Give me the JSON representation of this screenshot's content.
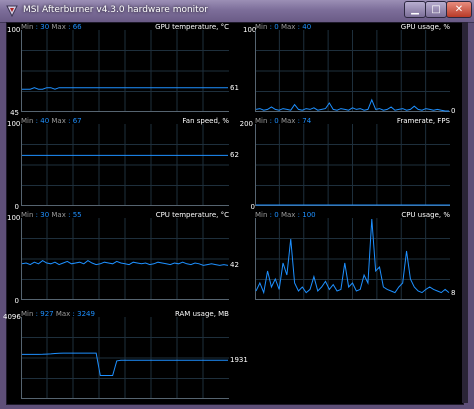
{
  "window": {
    "title": "MSI Afterburner v4.3.0 hardware monitor",
    "minimize_glyph": "▁",
    "maximize_glyph": "□",
    "close_glyph": "✕",
    "icon": "afterburner-icon"
  },
  "labels": {
    "min": "Min",
    "max": "Max"
  },
  "colors": {
    "graph_line": "#1e90ff",
    "grid": "#1e2f3c",
    "axis": "#566470",
    "background": "#000000"
  },
  "graphs": {
    "gpu_temp": {
      "name": "GPU temperature, °C",
      "min": "30",
      "max": "66",
      "y_top": "100",
      "y_bottom": "45",
      "current": "61",
      "range": [
        45,
        100
      ],
      "samples": [
        60,
        60,
        60,
        61,
        60,
        60,
        61,
        61,
        60,
        61,
        61,
        61,
        61,
        61,
        61,
        61,
        61,
        61,
        61,
        61,
        61,
        61,
        61,
        61,
        61,
        61,
        61,
        61,
        61,
        61,
        61,
        61,
        61,
        61,
        61,
        61,
        61,
        61,
        61,
        61,
        61,
        61,
        61,
        61,
        61,
        61,
        61,
        61,
        61,
        61,
        61
      ]
    },
    "gpu_usage": {
      "name": "GPU usage, %",
      "min": "0",
      "max": "40",
      "y_top": "100",
      "y_bottom": "0",
      "current": "0",
      "range": [
        0,
        100
      ],
      "samples": [
        2,
        3,
        1,
        2,
        5,
        2,
        1,
        3,
        2,
        1,
        8,
        2,
        1,
        3,
        2,
        4,
        1,
        2,
        3,
        10,
        2,
        1,
        3,
        2,
        1,
        4,
        2,
        3,
        1,
        2,
        14,
        2,
        3,
        1,
        2,
        5,
        1,
        2,
        3,
        1,
        2,
        6,
        2,
        1,
        3,
        2,
        1,
        2,
        1,
        0,
        0
      ]
    },
    "fan_speed": {
      "name": "Fan speed, %",
      "min": "40",
      "max": "67",
      "y_top": "100",
      "y_bottom": "0",
      "current": "62",
      "range": [
        0,
        100
      ],
      "samples": [
        62,
        62,
        62,
        62,
        62,
        62,
        62,
        62,
        62,
        62,
        62,
        62,
        62,
        62,
        62,
        62,
        62,
        62,
        62,
        62,
        62,
        62,
        62,
        62,
        62,
        62,
        62,
        62,
        62,
        62,
        62,
        62,
        62,
        62,
        62,
        62,
        62,
        62,
        62,
        62,
        62,
        62,
        62,
        62,
        62,
        62,
        62,
        62,
        62,
        62,
        62
      ]
    },
    "framerate": {
      "name": "Framerate, FPS",
      "min": "0",
      "max": "74",
      "y_top": "200",
      "y_bottom": "0",
      "current": "",
      "range": [
        0,
        200
      ],
      "samples": []
    },
    "cpu_temp": {
      "name": "CPU temperature, °C",
      "min": "30",
      "max": "55",
      "y_top": "100",
      "y_bottom": "0",
      "current": "42",
      "range": [
        0,
        100
      ],
      "samples": [
        44,
        45,
        43,
        46,
        44,
        48,
        45,
        44,
        46,
        43,
        45,
        47,
        44,
        45,
        46,
        44,
        48,
        45,
        43,
        44,
        46,
        45,
        44,
        47,
        45,
        44,
        43,
        46,
        45,
        44,
        45,
        43,
        44,
        46,
        45,
        44,
        43,
        45,
        44,
        46,
        44,
        43,
        45,
        44,
        42,
        43,
        44,
        43,
        42,
        43,
        42
      ]
    },
    "cpu_usage": {
      "name": "CPU usage, %",
      "min": "0",
      "max": "100",
      "y_top": "100",
      "y_bottom": "0",
      "current": "8",
      "range": [
        0,
        100
      ],
      "samples": [
        10,
        20,
        8,
        35,
        15,
        25,
        12,
        45,
        30,
        75,
        20,
        10,
        15,
        8,
        12,
        28,
        10,
        15,
        22,
        12,
        18,
        10,
        12,
        45,
        15,
        20,
        10,
        12,
        30,
        20,
        100,
        35,
        40,
        15,
        12,
        10,
        8,
        15,
        20,
        60,
        25,
        15,
        10,
        8,
        12,
        15,
        12,
        10,
        8,
        12,
        8
      ]
    },
    "ram_usage": {
      "name": "RAM usage, MB",
      "min": "927",
      "max": "3249",
      "y_top": "4096",
      "y_bottom": "0",
      "current": "1931",
      "range": [
        0,
        4096
      ],
      "samples": [
        2230,
        2230,
        2230,
        2230,
        2230,
        2240,
        2250,
        2260,
        2280,
        2290,
        2300,
        2300,
        2300,
        2300,
        2300,
        2300,
        2300,
        2300,
        2300,
        1150,
        1150,
        1150,
        1150,
        1900,
        1930,
        1930,
        1930,
        1930,
        1930,
        1930,
        1930,
        1930,
        1930,
        1930,
        1930,
        1930,
        1930,
        1930,
        1930,
        1930,
        1930,
        1930,
        1930,
        1930,
        1930,
        1930,
        1930,
        1930,
        1930,
        1930,
        1931
      ]
    }
  }
}
